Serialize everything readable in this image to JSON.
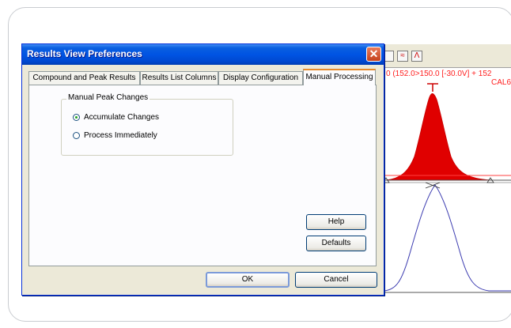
{
  "dialog": {
    "title": "Results View Preferences",
    "close_icon": "close-icon",
    "tabs": [
      {
        "label": "Compound and Peak Results"
      },
      {
        "label": "Results List Columns"
      },
      {
        "label": "Display Configuration"
      },
      {
        "label": "Manual Processing",
        "active": true
      }
    ],
    "group": {
      "label": "Manual Peak Changes",
      "options": [
        {
          "label": "Accumulate Changes",
          "selected": true
        },
        {
          "label": "Process Immediately",
          "selected": false
        }
      ]
    },
    "buttons": {
      "help": "Help",
      "defaults": "Defaults",
      "ok": "OK",
      "cancel": "Cancel"
    }
  },
  "background_app": {
    "toolbar_icons": [
      "peak-integration-icon",
      "overlay-icon"
    ],
    "trace_label": "0 (152.0>150.0 [-30.0V] + 152",
    "trace_sublabel": "CAL6",
    "colors": {
      "peak_fill": "#e00000",
      "trace_line": "#3b3bb0",
      "label": "#ff2020"
    }
  }
}
